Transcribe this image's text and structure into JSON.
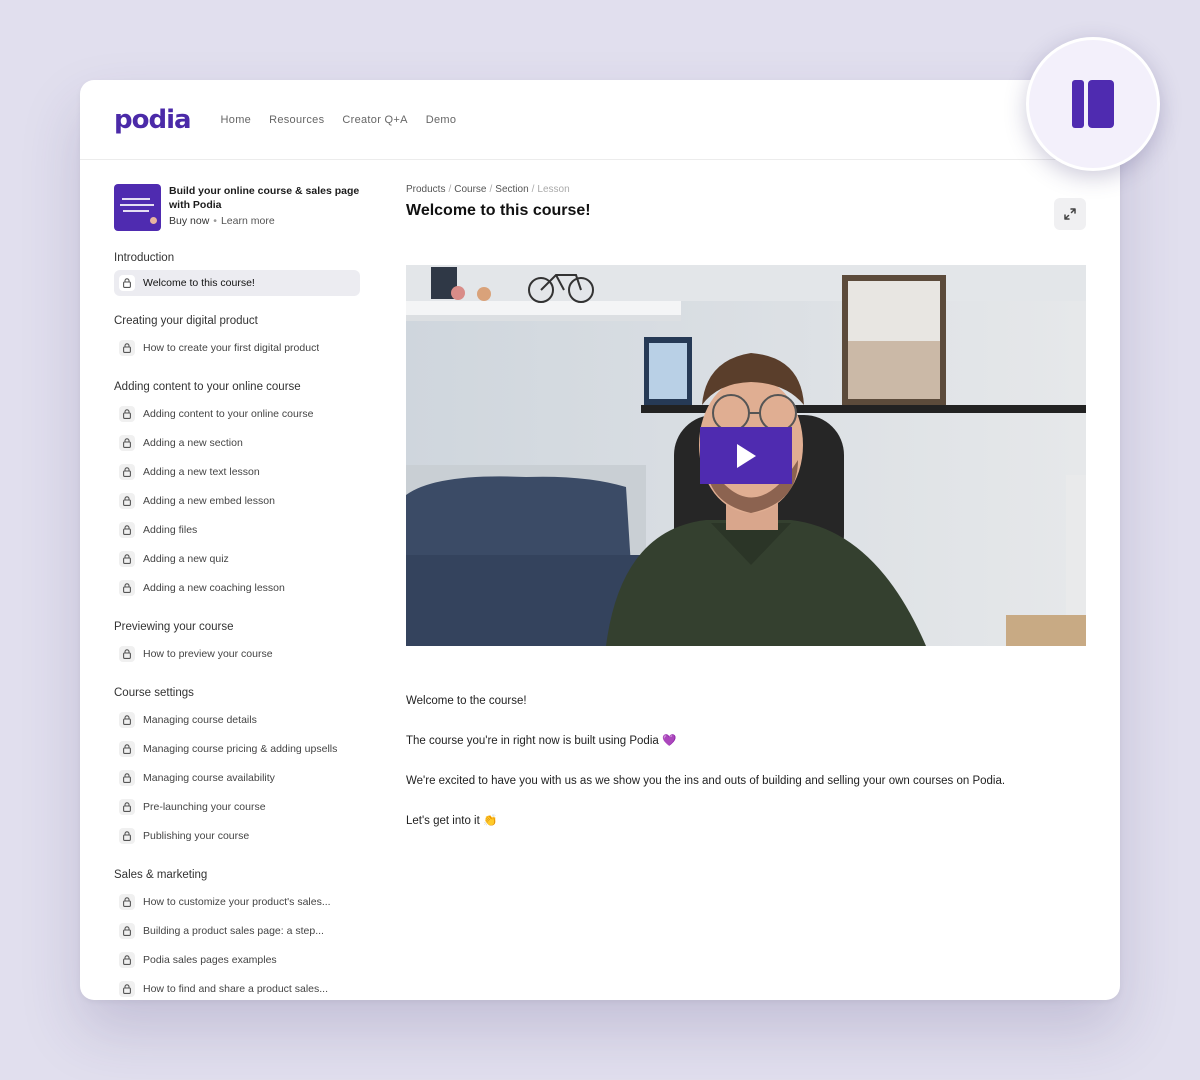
{
  "nav": {
    "logo": "podia",
    "links": [
      "Home",
      "Resources",
      "Creator Q+A",
      "Demo"
    ]
  },
  "product": {
    "title": "Build your online course & sales page with Podia",
    "buy_now": "Buy now",
    "separator": "•",
    "learn_more": "Learn more"
  },
  "sections": [
    {
      "title": "Introduction",
      "lessons": [
        "Welcome to this course!"
      ]
    },
    {
      "title": "Creating your digital product",
      "lessons": [
        "How to create your first digital product"
      ]
    },
    {
      "title": "Adding content to your online course",
      "lessons": [
        "Adding content to your online course",
        "Adding a new section",
        "Adding a new text lesson",
        "Adding a new embed lesson",
        "Adding files",
        "Adding a new quiz",
        "Adding a new coaching lesson"
      ]
    },
    {
      "title": "Previewing your course",
      "lessons": [
        "How to preview your course"
      ]
    },
    {
      "title": "Course settings",
      "lessons": [
        "Managing course details",
        "Managing course pricing & adding upsells",
        "Managing course availability",
        "Pre-launching your course",
        "Publishing your course"
      ]
    },
    {
      "title": "Sales & marketing",
      "lessons": [
        "How to customize your product's sales...",
        "Building a product sales page: a step...",
        "Podia sales pages examples",
        "How to find and share a product sales..."
      ]
    }
  ],
  "breadcrumb": {
    "products": "Products",
    "course": "Course",
    "section": "Section",
    "lesson": "Lesson",
    "separator": "/"
  },
  "lesson": {
    "title": "Welcome to this course!",
    "body": [
      "Welcome to the course!",
      "The course you're in right now is built using Podia 💜",
      "We're excited to have you with us as we show you the ins and outs of building and selling your own courses on Podia.",
      "Let's get into it 👏"
    ]
  },
  "colors": {
    "brand": "#4b2aa8",
    "play_button": "#4f2bb0",
    "page_background": "#e1dfee"
  },
  "icons": {
    "lock": "lock-icon",
    "expand": "expand-icon",
    "play": "play-icon",
    "sidebar_toggle": "sidebar-toggle-icon"
  }
}
